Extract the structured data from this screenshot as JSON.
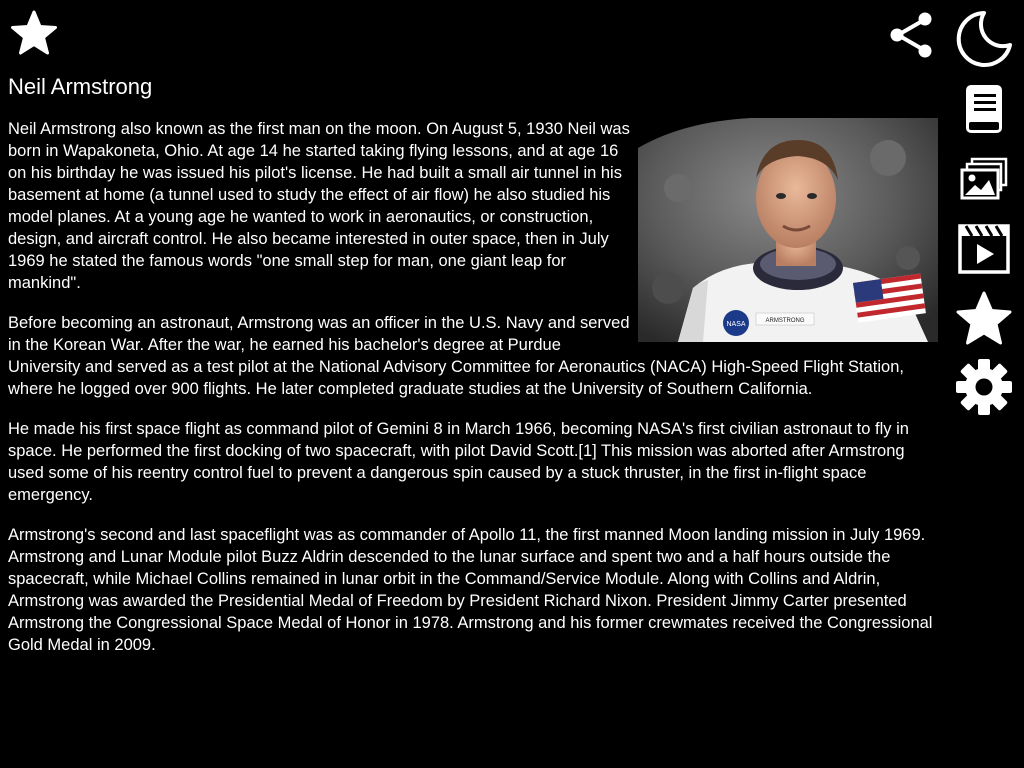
{
  "article": {
    "title": "Neil Armstrong",
    "paragraphs": [
      "Neil Armstrong also known as the first man on the moon. On August 5, 1930 Neil was born in Wapakoneta, Ohio. At age 14 he started taking flying lessons, and at age 16 on his birthday he was issued his pilot's license. He had built a small air tunnel in his basement at home (a tunnel used to study the effect of air flow) he also studied his model planes. At a young age he wanted to work in aeronautics, or construction, design, and aircraft control. He also became interested in outer space, then in July 1969 he stated the famous words \"one small step for man, one giant leap for mankind\".",
      "Before becoming an astronaut, Armstrong was an officer in the U.S. Navy and served in the Korean War. After the war, he earned his bachelor's degree at Purdue University and served as a test pilot at the National Advisory Committee for Aeronautics (NACA) High-Speed Flight Station, where he logged over 900 flights. He later completed graduate studies at the University of Southern California.",
      "He made his first space flight as command pilot of Gemini 8 in March 1966, becoming NASA's first civilian astronaut to fly in space. He performed the first docking of two spacecraft, with pilot David Scott.[1] This mission was aborted after Armstrong used some of his reentry control fuel to prevent a dangerous spin caused by a stuck thruster, in the first in-flight space emergency.",
      "Armstrong's second and last spaceflight was as commander of Apollo 11, the first manned Moon landing mission in July 1969. Armstrong and Lunar Module pilot Buzz Aldrin descended to the lunar surface and spent two and a half hours outside the spacecraft, while Michael Collins remained in lunar orbit in the Command/Service Module. Along with Collins and Aldrin, Armstrong was awarded the Presidential Medal of Freedom by President Richard Nixon. President Jimmy Carter presented Armstrong the Congressional Space Medal of Honor in 1978. Armstrong and his former crewmates received the Congressional Gold Medal in 2009."
    ]
  },
  "portrait": {
    "suit_badge": "NASA",
    "name_tag": "ARMSTRONG"
  },
  "toolbar": {
    "top_left": {
      "icon": "star-icon"
    },
    "top_right": {
      "icon": "share-icon"
    },
    "rail": [
      {
        "icon": "moon-icon"
      },
      {
        "icon": "book-icon"
      },
      {
        "icon": "gallery-icon"
      },
      {
        "icon": "video-icon"
      },
      {
        "icon": "star-icon"
      },
      {
        "icon": "gear-icon"
      }
    ]
  },
  "colors": {
    "background": "#000000",
    "text": "#ffffff",
    "icon": "#ffffff"
  }
}
